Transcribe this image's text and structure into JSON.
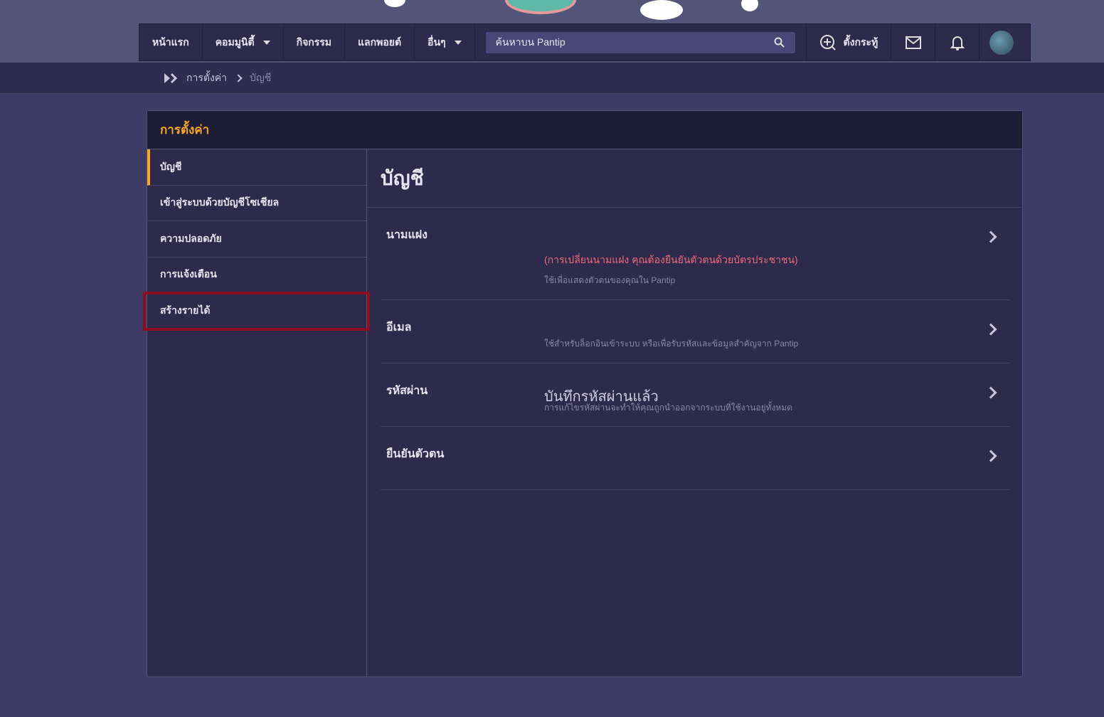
{
  "nav": {
    "items": [
      {
        "label": "หน้าแรก",
        "dropdown": false
      },
      {
        "label": "คอมมูนิตี้",
        "dropdown": true
      },
      {
        "label": "กิจกรรม",
        "dropdown": false
      },
      {
        "label": "แลกพอยต์",
        "dropdown": false
      },
      {
        "label": "อื่นๆ",
        "dropdown": true
      }
    ],
    "search_placeholder": "ค้นหาบน Pantip",
    "create_label": "ตั้งกระทู้"
  },
  "breadcrumb": {
    "items": [
      "การตั้งค่า",
      "บัญชี"
    ]
  },
  "panel": {
    "title": "การตั้งค่า",
    "sidebar": [
      "บัญชี",
      "เข้าสู่ระบบด้วยบัญชีโซเชียล",
      "ความปลอดภัย",
      "การแจ้งเตือน",
      "สร้างรายได้"
    ],
    "main_title": "บัญชี",
    "rows": [
      {
        "label": "นามแฝง",
        "warning": "(การเปลี่ยนนามแฝง คุณต้องยืนยันตัวตนด้วยบัตรประชาชน)",
        "description": "ใช้เพื่อแสดงตัวตนของคุณใน Pantip"
      },
      {
        "label": "อีเมล",
        "description": "ใช้สำหรับล็อกอินเข้าระบบ หรือเพื่อรับรหัสและข้อมูลสำคัญจาก Pantip"
      },
      {
        "label": "รหัสผ่าน",
        "value": "บันทึกรหัสผ่านแล้ว",
        "description": "การแก้ไขรหัสผ่านจะทำให้คุณถูกนำออกจากระบบที่ใช้งานอยู่ทั้งหมด"
      },
      {
        "label": "ยืนยันตัวตน"
      }
    ]
  },
  "colors": {
    "accent": "#f5a623",
    "warning": "#f06a78",
    "highlight": "#8b0f1e"
  }
}
